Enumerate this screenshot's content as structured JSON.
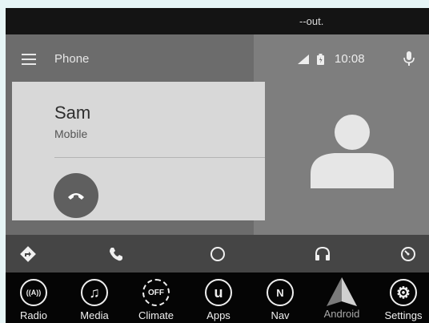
{
  "top_message": "--out.",
  "app_bar": {
    "title": "Phone",
    "clock": "10:08"
  },
  "call_card": {
    "name": "Sam",
    "type": "Mobile"
  },
  "bottom_bar": {
    "items": [
      {
        "label": "Radio",
        "glyph": "((A))"
      },
      {
        "label": "Media",
        "glyph": "♫"
      },
      {
        "label": "Climate",
        "glyph": "OFF"
      },
      {
        "label": "Apps",
        "glyph": "u"
      },
      {
        "label": "Nav",
        "glyph": "N"
      },
      {
        "label": "Android",
        "glyph": ""
      },
      {
        "label": "Settings",
        "glyph": "⚙"
      }
    ]
  },
  "colors": {
    "card": "#d8d8d8",
    "hangup": "#5f5f5f",
    "bezel": "#050505",
    "page": "#e6f5f6"
  }
}
